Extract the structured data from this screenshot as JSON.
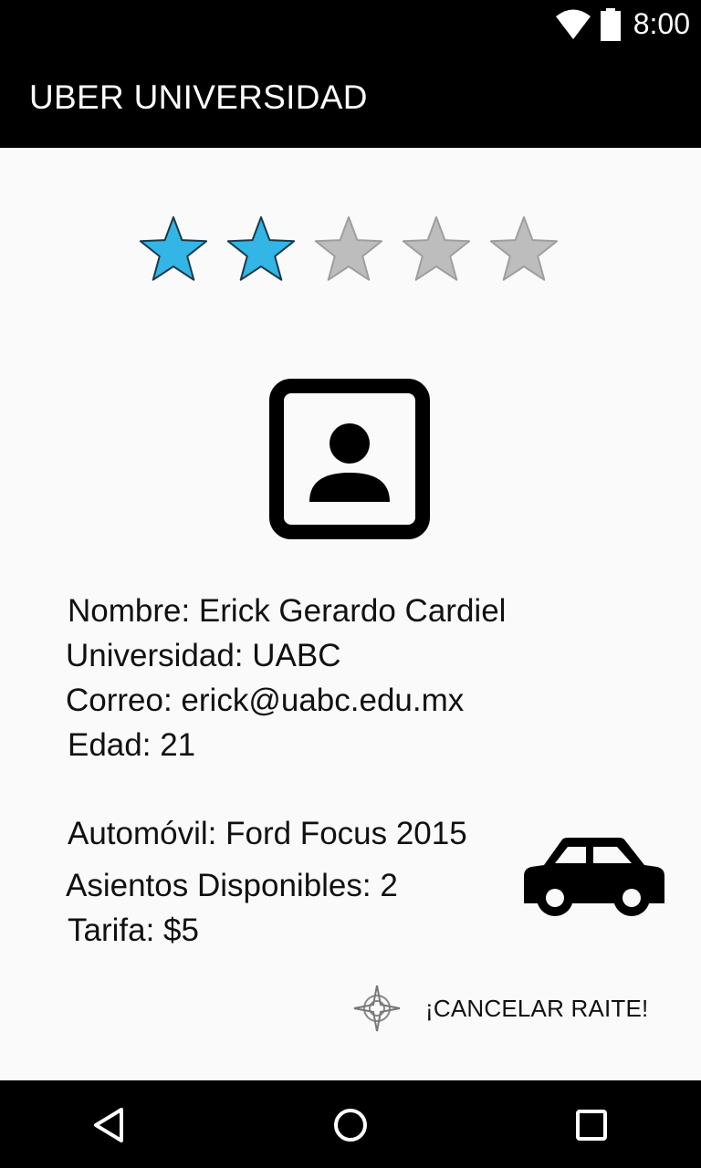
{
  "status_bar": {
    "time": "8:00"
  },
  "app_bar": {
    "title": "UBER UNIVERSIDAD"
  },
  "rating": {
    "value": 2,
    "max": 5,
    "filled_color": "#33b5e5",
    "empty_color": "#bdbdbd"
  },
  "profile": {
    "avatar_icon": "account-box-icon",
    "nombre": "Nombre: Erick Gerardo Cardiel",
    "universidad": "Universidad: UABC",
    "correo": "Correo: erick@uabc.edu.mx",
    "edad": "Edad: 21"
  },
  "vehicle": {
    "automovil": "Automóvil: Ford Focus 2015",
    "asientos": "Asientos Disponibles: 2",
    "tarifa": "Tarifa: $5",
    "icon": "car-icon"
  },
  "actions": {
    "cancel_label": "¡CANCELAR RAITE!",
    "cancel_icon": "compass-icon"
  },
  "nav": {
    "back": "back-icon",
    "home": "home-icon",
    "recents": "recents-icon"
  }
}
